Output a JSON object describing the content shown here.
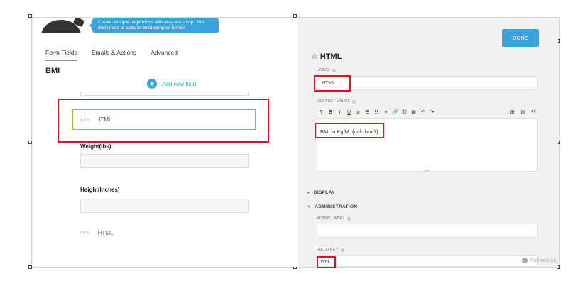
{
  "tooltip": {
    "line1": "Create multiple page forms with drag-and-drop. You",
    "line2": "don't need to code to build complex forms!"
  },
  "tabs": [
    {
      "label": "Form Fields",
      "active": true
    },
    {
      "label": "Emails & Actions",
      "active": false
    },
    {
      "label": "Advanced",
      "active": false
    }
  ],
  "form": {
    "title": "BMI",
    "add_field_label": "Add new field",
    "add_field_icon": "plus-circle-icon",
    "selected_field": {
      "icon": "code-icon",
      "icon_glyph": "</>",
      "label": "HTML"
    },
    "fields": [
      {
        "label": "Weight(lbs)"
      },
      {
        "label": "Height(Inches)"
      }
    ],
    "bottom_field": {
      "icon": "code-icon",
      "icon_glyph": "</>",
      "label": "HTML"
    }
  },
  "settings": {
    "done_label": "DONE",
    "panel_title": "HTML",
    "title_icon": "star-outline-icon",
    "label_caption": "LABEL",
    "label_value": "HTML",
    "default_value_caption": "DEFAULT VALUE",
    "default_value_text": "BMI in Kg/M: {calc:bmi1}",
    "toolbar": [
      "¶",
      "B",
      "I",
      "U",
      "⌀",
      "☰",
      "☷",
      "≡",
      "🔗",
      "⛓",
      "▦",
      "↶",
      "↷"
    ],
    "toolbar_right": [
      "⊞",
      "▤",
      "<>"
    ],
    "display_section": "DISPLAY",
    "administration_section": "ADMINISTRATION",
    "admin_label_caption": "ADMIN LABEL",
    "admin_label_value": "",
    "field_key_caption": "FIELD KEY",
    "field_key_value": "bmi",
    "full_screen_label": "Full screen"
  },
  "colors": {
    "accent": "#3aa3d8",
    "highlight_red": "#e0141e",
    "selected_green": "#8cc63f"
  }
}
